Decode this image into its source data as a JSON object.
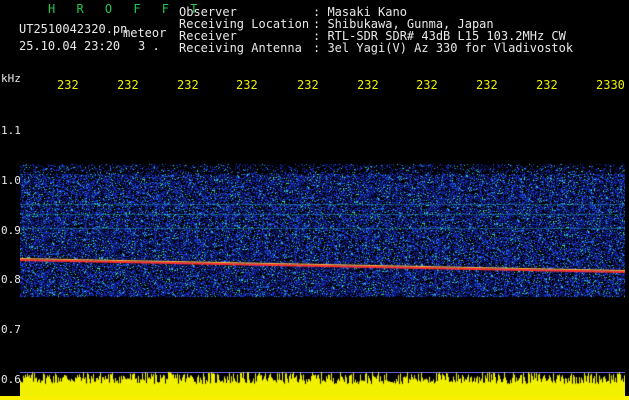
{
  "header": {
    "app_title": "H R O F F T",
    "file_name": "UT2510042320.pn",
    "mode": "meteor",
    "datetime": "25.10.04 23:20",
    "frame": "3 .",
    "fields": [
      {
        "label": "Observer",
        "value": ": Masaki Kano"
      },
      {
        "label": "Receiving Location",
        "value": ": Shibukawa, Gunma, Japan"
      },
      {
        "label": "Receiver",
        "value": ": RTL-SDR SDR# 43dB L15 103.2MHz CW"
      },
      {
        "label": "Receiving Antenna",
        "value": ": 3el Yagi(V) Az 330 for Vladivostok"
      }
    ]
  },
  "axis": {
    "unit": "kHz",
    "y_ticks": [
      "1.1",
      "1.0",
      "0.9",
      "0.8",
      "0.7",
      "0.6"
    ],
    "x_ticks": [
      "232",
      "232",
      "232",
      "232",
      "232",
      "232",
      "232",
      "232",
      "232",
      "2330"
    ]
  },
  "colors": {
    "background": "#000000",
    "signal_line": "#ff3030",
    "noise": "#1a2aa0",
    "power_trace": "#f0f000"
  }
}
